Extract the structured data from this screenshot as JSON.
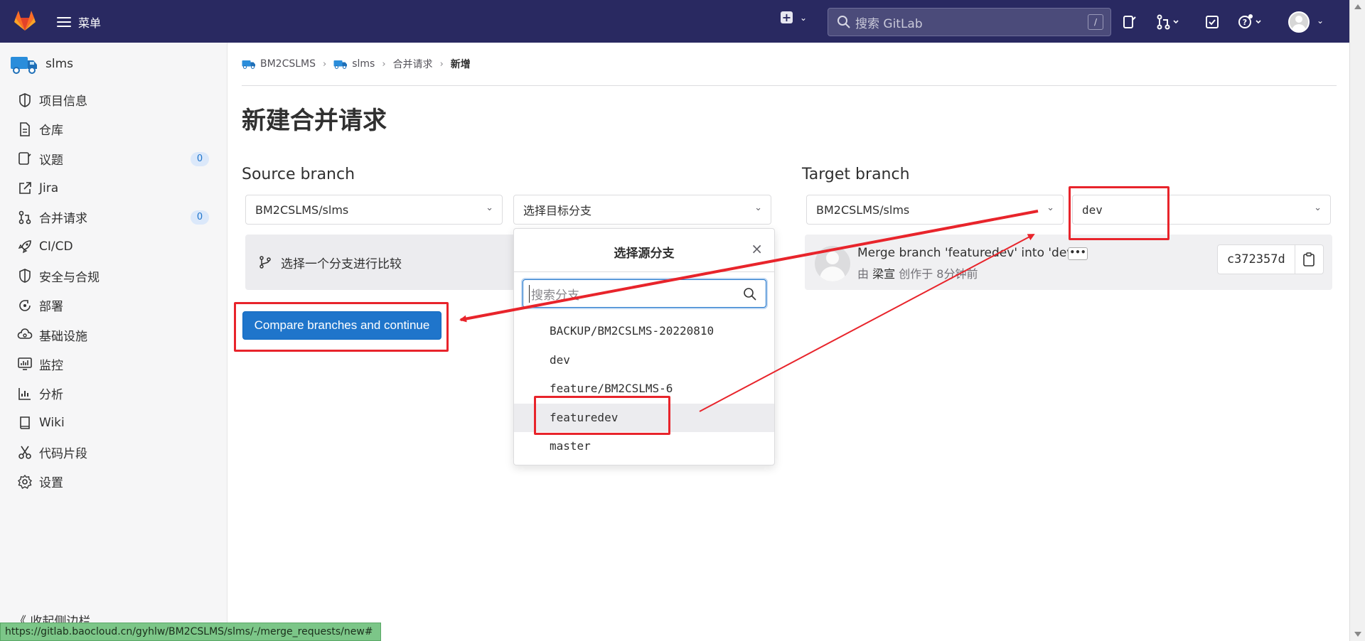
{
  "topbar": {
    "menu_label": "菜单",
    "search_placeholder": "搜索 GitLab",
    "search_shortcut": "/"
  },
  "sidebar": {
    "project_name": "slms",
    "items": [
      {
        "label": "项目信息",
        "icon": "info-icon"
      },
      {
        "label": "仓库",
        "icon": "document-icon"
      },
      {
        "label": "议题",
        "icon": "issues-icon",
        "badge": "0"
      },
      {
        "label": "Jira",
        "icon": "external-link-icon"
      },
      {
        "label": "合并请求",
        "icon": "merge-request-icon",
        "badge": "0"
      },
      {
        "label": "CI/CD",
        "icon": "rocket-icon"
      },
      {
        "label": "安全与合规",
        "icon": "shield-icon"
      },
      {
        "label": "部署",
        "icon": "deployments-icon"
      },
      {
        "label": "基础设施",
        "icon": "cloud-gear-icon"
      },
      {
        "label": "监控",
        "icon": "monitor-icon"
      },
      {
        "label": "分析",
        "icon": "chart-icon"
      },
      {
        "label": "Wiki",
        "icon": "book-icon"
      },
      {
        "label": "代码片段",
        "icon": "scissors-icon"
      },
      {
        "label": "设置",
        "icon": "gear-icon"
      }
    ],
    "collapse_label": "《 收起侧边栏"
  },
  "breadcrumb": {
    "group": "BM2CSLMS",
    "project": "slms",
    "section": "合并请求",
    "current": "新增"
  },
  "page": {
    "title": "新建合并请求",
    "source": {
      "heading": "Source branch",
      "project": "BM2CSLMS/slms",
      "branch_placeholder": "选择目标分支",
      "compare_hint": "选择一个分支进行比较"
    },
    "target": {
      "heading": "Target branch",
      "project": "BM2CSLMS/slms",
      "branch": "dev"
    },
    "compare_button": "Compare branches and continue",
    "commit": {
      "message": "Merge branch 'featuredev' into 'dev'",
      "by": "由",
      "author": "梁宣",
      "created": "创作于 8分钟前",
      "sha": "c372357d"
    }
  },
  "branch_dropdown": {
    "title": "选择源分支",
    "search_placeholder": "搜索分支",
    "branches": [
      "BACKUP/BM2CSLMS-20220810",
      "dev",
      "feature/BM2CSLMS-6",
      "featuredev",
      "master"
    ],
    "highlighted": "featuredev"
  },
  "status_url": "https://gitlab.baocloud.cn/gyhlw/BM2CSLMS/slms/-/merge_requests/new#",
  "colors": {
    "topbar": "#292961",
    "primary": "#1f75cb",
    "annotation": "#e8242b"
  }
}
